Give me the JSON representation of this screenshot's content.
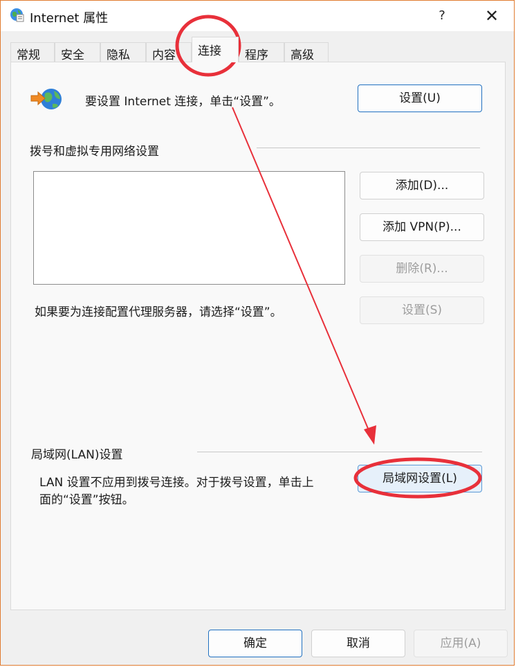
{
  "window": {
    "title": "Internet 属性",
    "help_label": "?",
    "close_label": "✕"
  },
  "tabs": [
    {
      "label": "常规"
    },
    {
      "label": "安全"
    },
    {
      "label": "隐私"
    },
    {
      "label": "内容"
    },
    {
      "label": "连接",
      "active": true
    },
    {
      "label": "程序"
    },
    {
      "label": "高级"
    }
  ],
  "setup": {
    "text": "要设置 Internet 连接，单击“设置”。",
    "button": "设置(U)"
  },
  "dialup": {
    "heading": "拨号和虚拟专用网络设置",
    "add_button": "添加(D)...",
    "add_vpn_button": "添加 VPN(P)...",
    "remove_button": "删除(R)...",
    "proxy_text": "如果要为连接配置代理服务器，请选择“设置”。",
    "settings_button": "设置(S)"
  },
  "lan": {
    "heading": "局域网(LAN)设置",
    "text_line1": "LAN 设置不应用到拨号连接。对于拨号设置，单击上",
    "text_line2": "面的“设置”按钮。",
    "button": "局域网设置(L)"
  },
  "footer": {
    "ok": "确定",
    "cancel": "取消",
    "apply": "应用(A)"
  },
  "annotation_color": "#e8303a"
}
